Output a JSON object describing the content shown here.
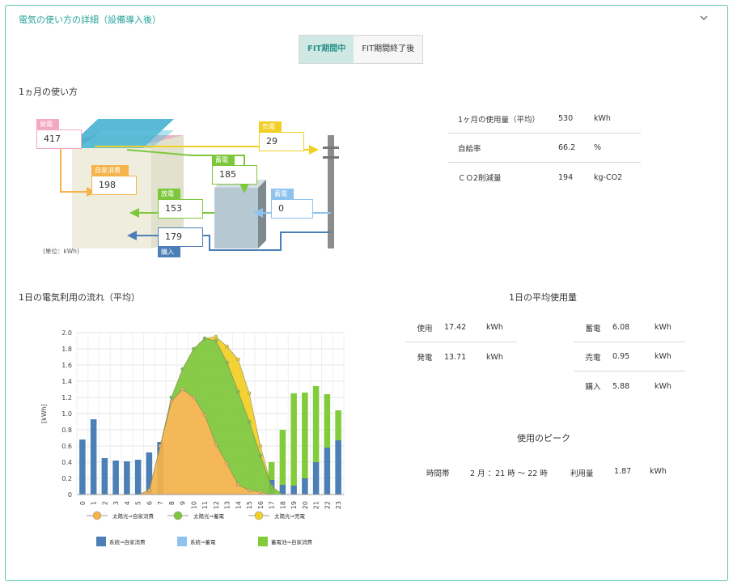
{
  "header": {
    "title": "電気の使い方の詳細（設備導入後）"
  },
  "tabs": [
    {
      "label": "FIT期間中",
      "active": true
    },
    {
      "label": "FIT期間終了後",
      "active": false
    }
  ],
  "monthly": {
    "title": "1ヵ月の使い方",
    "unit_note": "(単位：kWh)",
    "flows": {
      "generation": {
        "label": "発電",
        "value": "417"
      },
      "self_consumption": {
        "label": "自家消費",
        "value": "198"
      },
      "sold": {
        "label": "売電",
        "value": "29"
      },
      "stored_solar": {
        "label": "蓄電",
        "value": "185"
      },
      "discharge": {
        "label": "放電",
        "value": "153"
      },
      "stored_grid": {
        "label": "蓄電",
        "value": "0"
      },
      "purchase": {
        "label": "購入",
        "value": "179"
      }
    },
    "stats": [
      {
        "label": "1ヶ月の使用量（平均）",
        "value": "530",
        "unit": "kWh"
      },
      {
        "label": "自給率",
        "value": "66.2",
        "unit": "%"
      },
      {
        "label": "ＣＯ2削減量",
        "value": "194",
        "unit": "kg-CO2"
      }
    ]
  },
  "daily": {
    "title": "1日の電気利用の流れ（平均）",
    "avg_title": "1日の平均使用量",
    "avg_left": [
      {
        "label": "使用",
        "value": "17.42",
        "unit": "kWh"
      },
      {
        "label": "発電",
        "value": "13.71",
        "unit": "kWh"
      }
    ],
    "avg_right": [
      {
        "label": "蓄電",
        "value": "6.08",
        "unit": "kWh"
      },
      {
        "label": "売電",
        "value": "0.95",
        "unit": "kWh"
      },
      {
        "label": "購入",
        "value": "5.88",
        "unit": "kWh"
      }
    ],
    "peak_title": "使用のピーク",
    "peak": {
      "label_time": "時間帯",
      "time": "2 月 ：21 時 ～ 22 時",
      "label_usage": "利用量",
      "usage": "1.87",
      "unit": "kWh"
    }
  },
  "colors": {
    "accent": "#27a39a",
    "solar_self": "#f5b34a",
    "solar_store": "#7dc73a",
    "solar_sell": "#f2cf24",
    "grid_self": "#4b7fb5",
    "grid_store": "#8fc3ef",
    "battery_self": "#82cc3c"
  },
  "chart_data": {
    "type": "area",
    "ylabel": "[kWh]",
    "ylim": [
      0,
      2.0
    ],
    "yticks": [
      "0",
      "0.2",
      "0.4",
      "0.6",
      "0.8",
      "1.0",
      "1.2",
      "1.4",
      "1.6",
      "1.8",
      "2.0"
    ],
    "x": [
      "0",
      "1",
      "2",
      "3",
      "4",
      "5",
      "6",
      "7",
      "8",
      "9",
      "10",
      "11",
      "12",
      "13",
      "14",
      "15",
      "16",
      "17",
      "18",
      "19",
      "20",
      "21",
      "22",
      "23"
    ],
    "area_series": [
      {
        "name": "太陽光⇒自家消費",
        "values": [
          0,
          0,
          0,
          0,
          0,
          0,
          0.05,
          0.6,
          1.15,
          1.3,
          1.2,
          0.98,
          0.62,
          0.38,
          0.12,
          0.05,
          0.03,
          0,
          0,
          0,
          0,
          0,
          0,
          0
        ]
      },
      {
        "name": "太陽光⇒蓄電",
        "values": [
          0,
          0,
          0,
          0,
          0,
          0,
          0,
          0,
          0.05,
          0.25,
          0.6,
          0.95,
          1.28,
          1.25,
          1.15,
          0.85,
          0.45,
          0.1,
          0,
          0,
          0,
          0,
          0,
          0
        ]
      },
      {
        "name": "太陽光⇒売電",
        "values": [
          0,
          0,
          0,
          0,
          0,
          0,
          0,
          0,
          0,
          0,
          0,
          0,
          0.05,
          0.2,
          0.4,
          0.35,
          0.12,
          0,
          0,
          0,
          0,
          0,
          0,
          0
        ]
      }
    ],
    "bar_series": [
      {
        "name": "系統⇒自家消費",
        "values": [
          0.68,
          0.93,
          0.45,
          0.42,
          0.41,
          0.43,
          0.52,
          0.65,
          0,
          0,
          0,
          0,
          0,
          0,
          0,
          0,
          0,
          0.18,
          0.12,
          0.11,
          0.2,
          0.4,
          0.58,
          0.67
        ]
      },
      {
        "name": "系統⇒蓄電",
        "values": [
          0,
          0,
          0,
          0,
          0,
          0,
          0,
          0,
          0,
          0,
          0,
          0,
          0,
          0,
          0,
          0,
          0,
          0,
          0,
          0,
          0,
          0,
          0,
          0
        ]
      },
      {
        "name": "蓄電池⇒自家消費",
        "values": [
          0,
          0,
          0,
          0,
          0,
          0,
          0,
          0,
          0,
          0,
          0,
          0,
          0,
          0,
          0,
          0,
          0,
          0.22,
          0.68,
          1.14,
          1.06,
          0.94,
          0.66,
          0.37
        ]
      }
    ]
  }
}
